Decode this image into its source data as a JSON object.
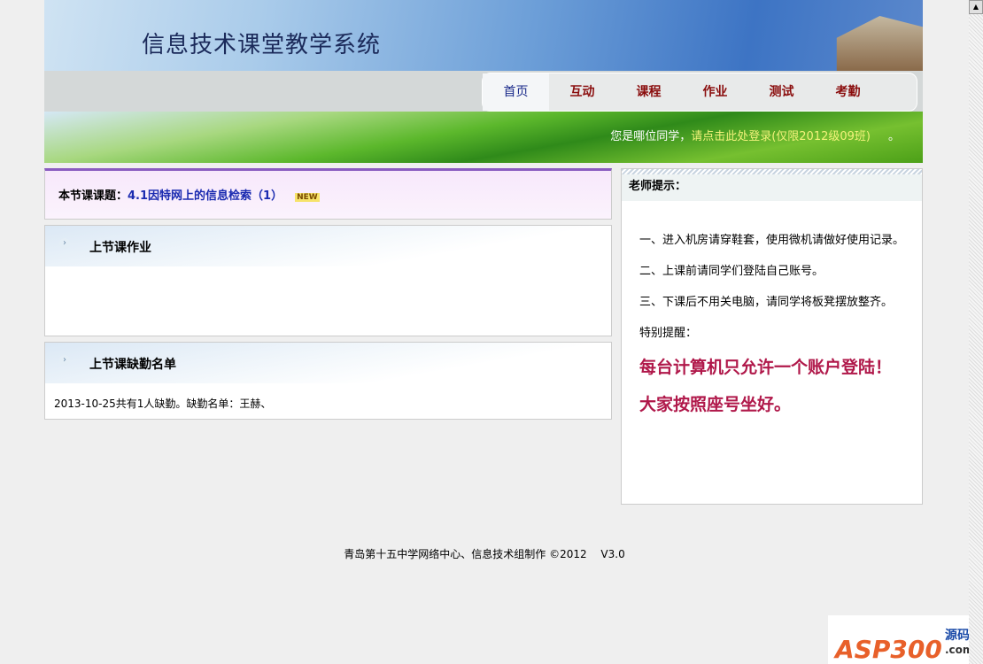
{
  "header": {
    "title": "信息技术课堂教学系统"
  },
  "nav": [
    "首页",
    "互动",
    "课程",
    "作业",
    "测试",
    "考勤"
  ],
  "login": {
    "prefix": "您是哪位同学，",
    "link": "请点击此处登录(仅限2012级09班)",
    "suffix": "。"
  },
  "topic": {
    "label": "本节课课题：",
    "value": "4.1因特网上的信息检索（1）",
    "badge": "NEW"
  },
  "homework": {
    "title": "上节课作业"
  },
  "absence": {
    "title": "上节课缺勤名单",
    "text": "2013-10-25共有1人缺勤。缺勤名单：王赫、"
  },
  "tips": {
    "title": "老师提示：",
    "items": [
      "一、进入机房请穿鞋套，使用微机请做好使用记录。",
      "二、上课前请同学们登陆自己账号。",
      "三、下课后不用关电脑，请同学将板凳摆放整齐。",
      "特别提醒："
    ],
    "highlights": [
      "每台计算机只允许一个账户登陆！",
      "大家按照座号坐好。"
    ]
  },
  "footer": "青岛第十五中学网络中心、信息技术组制作 ©2012　 V3.0",
  "logo": {
    "main": "ASP300",
    "cn": "源码",
    "dom": ".com"
  }
}
